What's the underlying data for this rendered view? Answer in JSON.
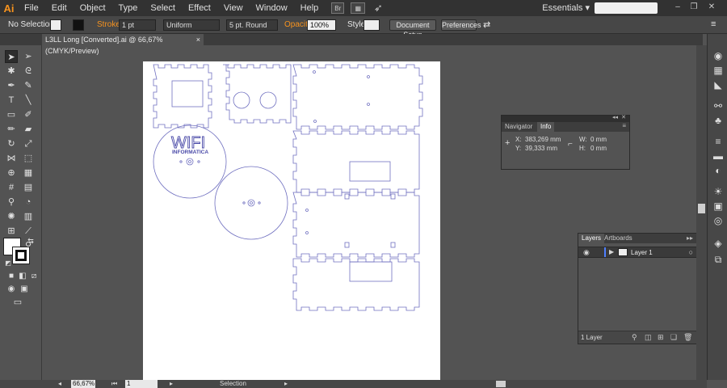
{
  "app": {
    "logo": "Ai"
  },
  "menu": [
    "File",
    "Edit",
    "Object",
    "Type",
    "Select",
    "Effect",
    "View",
    "Window",
    "Help"
  ],
  "menubar_icons": {
    "bridge": "Br"
  },
  "workspace": {
    "label": "Essentials",
    "chevron": "▾"
  },
  "window_controls": {
    "minimize": "–",
    "restore": "❐",
    "close": "✕"
  },
  "controlbar": {
    "selection": "No Selection",
    "stroke_label": "Stroke:",
    "stroke_weight": "1 pt",
    "profile": "Uniform",
    "brush": "5 pt. Round",
    "opacity_label": "Opacity:",
    "opacity_value": "100%",
    "style_label": "Style:",
    "doc_setup": "Document Setup",
    "preferences": "Preferences"
  },
  "document_tab": {
    "title": "L3LL Long [Converted].ai @ 66,67% (CMYK/Preview)",
    "close": "×"
  },
  "artwork": {
    "logo_text": "WIFI",
    "logo_subtext": "INFORMATICA"
  },
  "info_panel": {
    "tabs": [
      "Navigator",
      "Info"
    ],
    "active_tab": "Info",
    "x_label": "X:",
    "x_value": "383,269 mm",
    "y_label": "Y:",
    "y_value": "39,333 mm",
    "w_label": "W:",
    "w_value": "0 mm",
    "h_label": "H:",
    "h_value": "0 mm"
  },
  "layers_panel": {
    "tabs": [
      "Layers",
      "Artboards"
    ],
    "active_tab": "Layers",
    "layers": [
      {
        "name": "Layer 1",
        "color": "#4f7fff"
      }
    ],
    "count": "1 Layer"
  },
  "statusbar": {
    "zoom": "66,67%",
    "artboard": "1",
    "tool": "Selection"
  },
  "colors": {
    "accent": "#f7931e",
    "path": "#7070c0",
    "logo": "#4a4aa8"
  }
}
